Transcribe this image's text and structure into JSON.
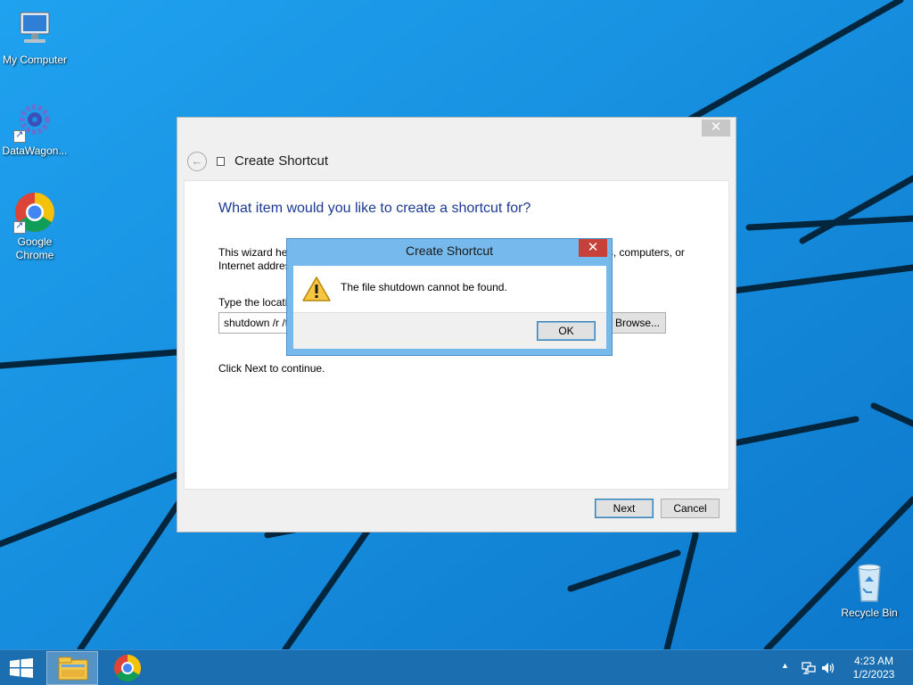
{
  "desktop": {
    "icons": [
      {
        "label": "My Computer",
        "icon": "computer-icon"
      },
      {
        "label": "DataWagon...",
        "icon": "gear-icon"
      },
      {
        "label": "Google Chrome",
        "icon": "chrome-icon"
      },
      {
        "label": "Recycle Bin",
        "icon": "recycle-bin-icon"
      }
    ]
  },
  "wizard": {
    "close_glyph": "✕",
    "back_glyph": "←",
    "title": "Create Shortcut",
    "heading": "What item would you like to create a shortcut for?",
    "description": "This wizard helps you to create shortcuts to local or network programs, files, folders, computers, or Internet addresses.",
    "location_label": "Type the location of the item:",
    "location_value": "shutdown /r /t 0",
    "browse_label": "Browse...",
    "continue_text": "Click Next to continue.",
    "next_label": "Next",
    "cancel_label": "Cancel"
  },
  "error_dialog": {
    "title": "Create Shortcut",
    "close_glyph": "✕",
    "message": "The file shutdown cannot be found.",
    "ok_label": "OK",
    "icon": "warning-icon"
  },
  "taskbar": {
    "items": [
      "file-explorer-icon",
      "chrome-icon"
    ],
    "tray_arrow": "▲",
    "time": "4:23 AM",
    "date": "1/2/2023"
  },
  "colors": {
    "desktop_bg": "#1a8fe0",
    "taskbar_bg": "#1b6fb0",
    "heading_blue": "#1c3a93",
    "dialog_frame": "#76b9ed",
    "close_red": "#c7403a"
  }
}
